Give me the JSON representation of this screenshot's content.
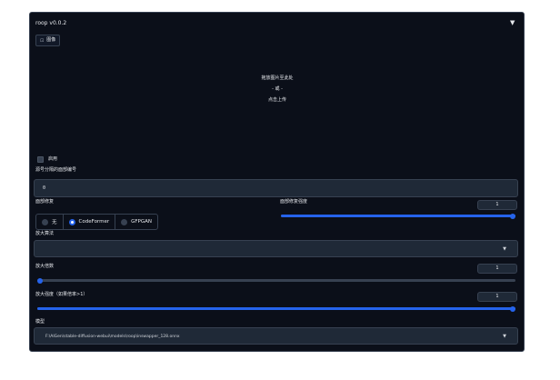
{
  "header": {
    "title": "roop v0.0.2",
    "collapse_icon": "triangle-down-icon",
    "image_tab_icon": "image-icon",
    "image_tab_label": "图像"
  },
  "upload": {
    "line1": "拖放图片至此处",
    "line2": "- 或 -",
    "line3": "点击上传"
  },
  "enable": {
    "label": "启用",
    "checked": false
  },
  "face_index": {
    "label": "源号分隔的面部编号",
    "value": "0"
  },
  "restore": {
    "label": "面部修复",
    "options": [
      "无",
      "CodeFormer",
      "GFPGAN"
    ],
    "selected": "CodeFormer"
  },
  "restore_visibility": {
    "label": "面部修复强度",
    "value": "1",
    "level": 1.0
  },
  "upscaler": {
    "label": "放大算法",
    "value": ""
  },
  "upscale_factor": {
    "label": "放大倍数",
    "value": "1",
    "level": 0.0
  },
  "upscale_visibility": {
    "label": "放大强度（如果倍率>1）",
    "value": "1",
    "level": 1.0
  },
  "model": {
    "label": "模型",
    "value": "F:\\AIGen\\stable-diffusion-webui\\models\\roop\\inswapper_128.onnx"
  },
  "colors": {
    "accent": "#2563eb",
    "panel": "#0b0f19",
    "field": "#1f2937"
  }
}
